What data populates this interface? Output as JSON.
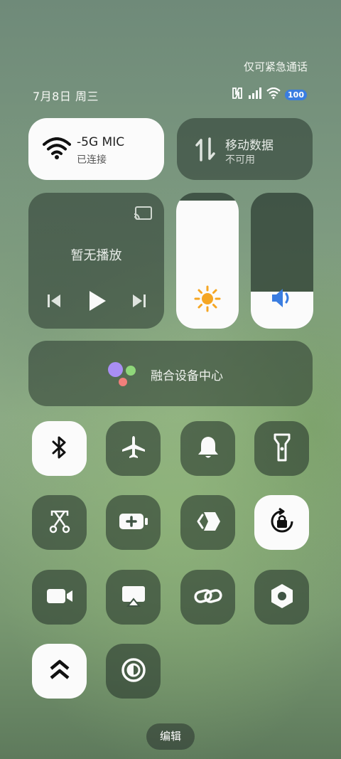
{
  "status": {
    "emergency": "仅可紧急通话",
    "date": "7月8日 周三",
    "battery": "100"
  },
  "wifi": {
    "ssid": "-5G      MIC",
    "status": "已连接"
  },
  "mobile_data": {
    "title": "移动数据",
    "status": "不可用"
  },
  "media": {
    "title": "暂无播放"
  },
  "sliders": {
    "brightness": 0.94,
    "volume": 0.27
  },
  "fusion": {
    "label": "融合设备中心"
  },
  "toggles": [
    {
      "name": "bluetooth",
      "on": true
    },
    {
      "name": "airplane-mode",
      "on": false
    },
    {
      "name": "ring",
      "on": false
    },
    {
      "name": "flashlight",
      "on": false
    },
    {
      "name": "screenshot",
      "on": false
    },
    {
      "name": "battery-saver",
      "on": false
    },
    {
      "name": "nfc-share",
      "on": false
    },
    {
      "name": "rotation-lock",
      "on": true
    },
    {
      "name": "screen-record",
      "on": false
    },
    {
      "name": "screen-cast",
      "on": false
    },
    {
      "name": "link",
      "on": false
    },
    {
      "name": "settings-hex",
      "on": false
    },
    {
      "name": "performance",
      "on": true
    },
    {
      "name": "dark-mode",
      "on": false
    }
  ],
  "edit": "编辑",
  "colors": {
    "accent": "#3a7de0",
    "sun": "#f5a623",
    "speaker": "#3a7de0",
    "tile_on": "#fbfbfb"
  }
}
